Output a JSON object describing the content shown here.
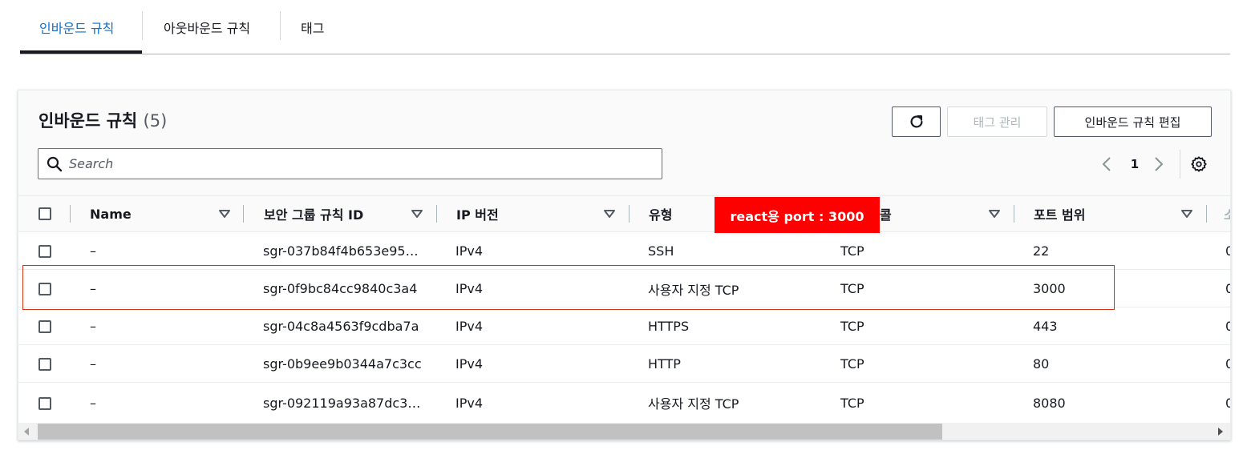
{
  "tabs": [
    {
      "label": "인바운드 규칙",
      "active": true
    },
    {
      "label": "아웃바운드 규칙",
      "active": false
    },
    {
      "label": "태그",
      "active": false
    }
  ],
  "panel": {
    "title": "인바운드 규칙",
    "count": "(5)",
    "buttons": {
      "refresh_icon": "refresh-icon",
      "manage_tags": "태그 관리",
      "edit_inbound": "인바운드 규칙 편집"
    },
    "search": {
      "placeholder": "Search",
      "value": ""
    },
    "pagination": {
      "current_page": "1"
    }
  },
  "table": {
    "columns": [
      "Name",
      "보안 그룹 규칙 ID",
      "IP 버전",
      "유형",
      "콜",
      "포트 범위",
      "소"
    ],
    "rows": [
      {
        "name": "–",
        "rule_id": "sgr-037b84f4b653e95…",
        "ip_version": "IPv4",
        "type": "SSH",
        "protocol": "TCP",
        "port": "22",
        "source": "0"
      },
      {
        "name": "–",
        "rule_id": "sgr-0f9bc84cc9840c3a4",
        "ip_version": "IPv4",
        "type": "사용자 지정 TCP",
        "protocol": "TCP",
        "port": "3000",
        "source": "0"
      },
      {
        "name": "–",
        "rule_id": "sgr-04c8a4563f9cdba7a",
        "ip_version": "IPv4",
        "type": "HTTPS",
        "protocol": "TCP",
        "port": "443",
        "source": "0"
      },
      {
        "name": "–",
        "rule_id": "sgr-0b9ee9b0344a7c3cc",
        "ip_version": "IPv4",
        "type": "HTTP",
        "protocol": "TCP",
        "port": "80",
        "source": "0"
      },
      {
        "name": "–",
        "rule_id": "sgr-092119a93a87dc3…",
        "ip_version": "IPv4",
        "type": "사용자 지정 TCP",
        "protocol": "TCP",
        "port": "8080",
        "source": "0"
      }
    ]
  },
  "annotation": {
    "text": "react용 port : 3000"
  },
  "colors": {
    "accent": "#0972d3",
    "annotation_bg": "#ff0000",
    "highlight_border": "#d13212"
  }
}
